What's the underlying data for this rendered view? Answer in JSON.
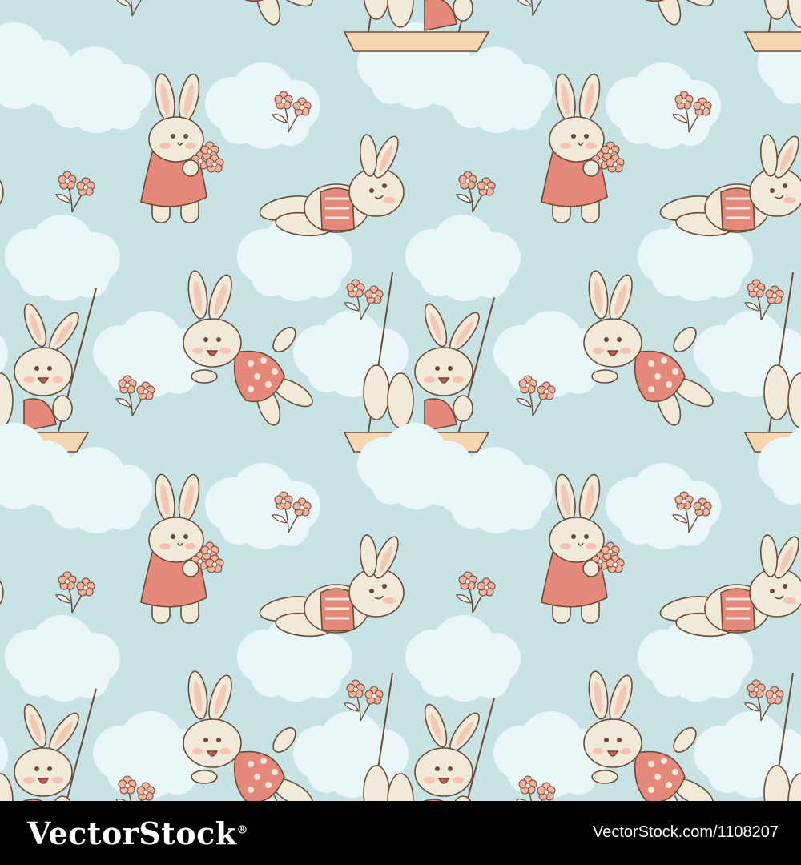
{
  "pattern": {
    "background_color": "#c8e3e4",
    "cloud_color": "#eaf6f8",
    "bunny_fur_color": "#f2ead8",
    "outline_color": "#6b4a3a",
    "dress_color": "#e58a7a",
    "polka_dot_color": "#fbe7dc",
    "swing_seat_color": "#f6d7b2",
    "flower_color": "#f4b39f"
  },
  "footer": {
    "logo_text": "VectorStock",
    "logo_mark": "®",
    "credit_text": "VectorStock.com/1108207"
  }
}
